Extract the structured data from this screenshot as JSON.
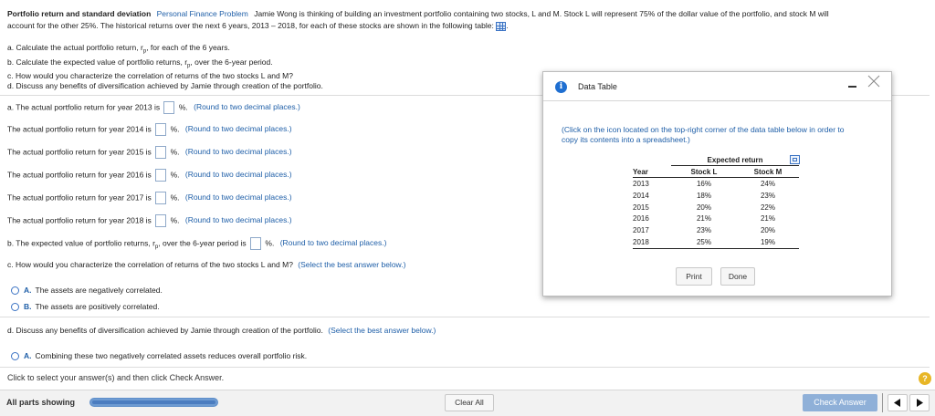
{
  "header": {
    "title": "Portfolio return and standard deviation",
    "category": "Personal Finance Problem",
    "intro_line1": "Jamie Wong is thinking of building an investment portfolio containing two stocks, L and M.  Stock L will represent 75% of the dollar value of the  portfolio, and stock M will",
    "intro_line2": "account for the other 25%.  The historical returns over the next 6 years, 2013 – 2018, for each of these stocks are shown in the following table:"
  },
  "tasks": {
    "a": "a.  Calculate the actual portfolio return, r",
    "a_sub": "p",
    "a_end": ", for each of the 6 years.",
    "b": "b.  Calculate the expected value of portfolio returns, r",
    "b_sub": "p",
    "b_end": ", over the 6-year period.",
    "c": "c.  How would you characterize the correlation of returns of the two stocks L and M?",
    "d": "d.  Discuss any benefits of diversification achieved by Jamie through creation of the portfolio."
  },
  "part_a": {
    "first_prefix": "a.  The actual portfolio return for year 2013 is",
    "rows": [
      {
        "prefix": "The actual portfolio return for year 2014 is"
      },
      {
        "prefix": "The actual portfolio return for year 2015 is"
      },
      {
        "prefix": "The actual portfolio return for year 2016 is"
      },
      {
        "prefix": "The actual portfolio return for year 2017 is"
      },
      {
        "prefix": "The actual portfolio return for year 2018 is"
      }
    ],
    "suffix": "%.",
    "hint": "(Round to two decimal places.)"
  },
  "part_b": {
    "prefix": "b.  The expected value of portfolio returns, r",
    "sub": "p",
    "mid": ", over the 6-year period is",
    "suffix": "%.",
    "hint": "(Round to two decimal places.)"
  },
  "part_c": {
    "question": "c.  How would you characterize the correlation of returns of the two stocks L and M?",
    "hint": "(Select the best answer below.)",
    "options": [
      {
        "letter": "A.",
        "text": "The assets are negatively correlated."
      },
      {
        "letter": "B.",
        "text": "The assets are positively correlated."
      }
    ]
  },
  "part_d": {
    "question": "d.  Discuss any benefits of diversification achieved by Jamie through creation of the portfolio.",
    "hint": "(Select the best answer below.)",
    "options": [
      {
        "letter": "A.",
        "text": "Combining these two negatively correlated assets reduces overall portfolio risk."
      }
    ]
  },
  "instruction": "Click to select your answer(s) and then click Check Answer.",
  "footer": {
    "status": "All parts showing",
    "clear": "Clear All",
    "check": "Check Answer",
    "help": "?"
  },
  "dialog": {
    "title": "Data Table",
    "info_glyph": "i",
    "note_line1": "(Click on the icon located on the top-right corner of the data table below in order to",
    "note_line2": "copy its contents into a spreadsheet.)",
    "table": {
      "group_header": "Expected return",
      "columns": [
        "Year",
        "Stock L",
        "Stock M"
      ],
      "rows": [
        [
          "2013",
          "16%",
          "24%"
        ],
        [
          "2014",
          "18%",
          "23%"
        ],
        [
          "2015",
          "20%",
          "22%"
        ],
        [
          "2016",
          "21%",
          "21%"
        ],
        [
          "2017",
          "23%",
          "20%"
        ],
        [
          "2018",
          "25%",
          "19%"
        ]
      ]
    },
    "print": "Print",
    "done": "Done"
  },
  "colors": {
    "accent_blue": "#1f5fa8",
    "check_button": "#8fb0d8",
    "footer_bg": "#f2f2f2"
  }
}
